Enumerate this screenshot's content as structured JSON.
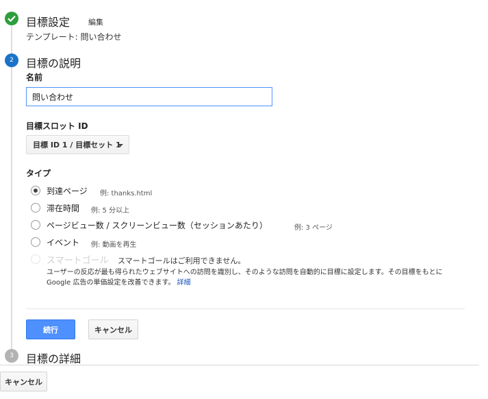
{
  "step1": {
    "title": "目標設定",
    "edit_label": "編集",
    "template": "テンプレート: 問い合わせ"
  },
  "step2": {
    "number": "2",
    "title": "目標の説明",
    "name_label": "名前",
    "name_value": "問い合わせ",
    "slot_label": "目標スロット ID",
    "slot_value": "目標 ID 1 / 目標セット 1",
    "type_label": "タイプ",
    "types": [
      {
        "label": "到達ページ",
        "example": "例: thanks.html",
        "checked": true
      },
      {
        "label": "滞在時間",
        "example": "例: 5 分以上",
        "checked": false
      },
      {
        "label": "ページビュー数 / スクリーンビュー数（セッションあたり）",
        "example": "例: 3 ページ",
        "checked": false
      },
      {
        "label": "イベント",
        "example": "例: 動画を再生",
        "checked": false
      }
    ],
    "smart_goal": {
      "label": "スマートゴール",
      "note": "スマートゴールはご利用できません。",
      "description": "ユーザーの反応が最も得られたウェブサイトへの訪問を識別し、そのような訪問を自動的に目標に設定します。その目標をもとに Google 広告の単価設定を改善できます。",
      "link": "詳細"
    },
    "continue_label": "続行",
    "cancel_label": "キャンセル"
  },
  "step3": {
    "number": "3",
    "title": "目標の詳細"
  },
  "footer": {
    "cancel_label": "キャンセル"
  },
  "colors": {
    "complete": "#2e9e3e",
    "active": "#1a73c9",
    "inactive": "#b3b3b3",
    "primary_button": "#4d90fe",
    "link": "#1a56b8"
  }
}
